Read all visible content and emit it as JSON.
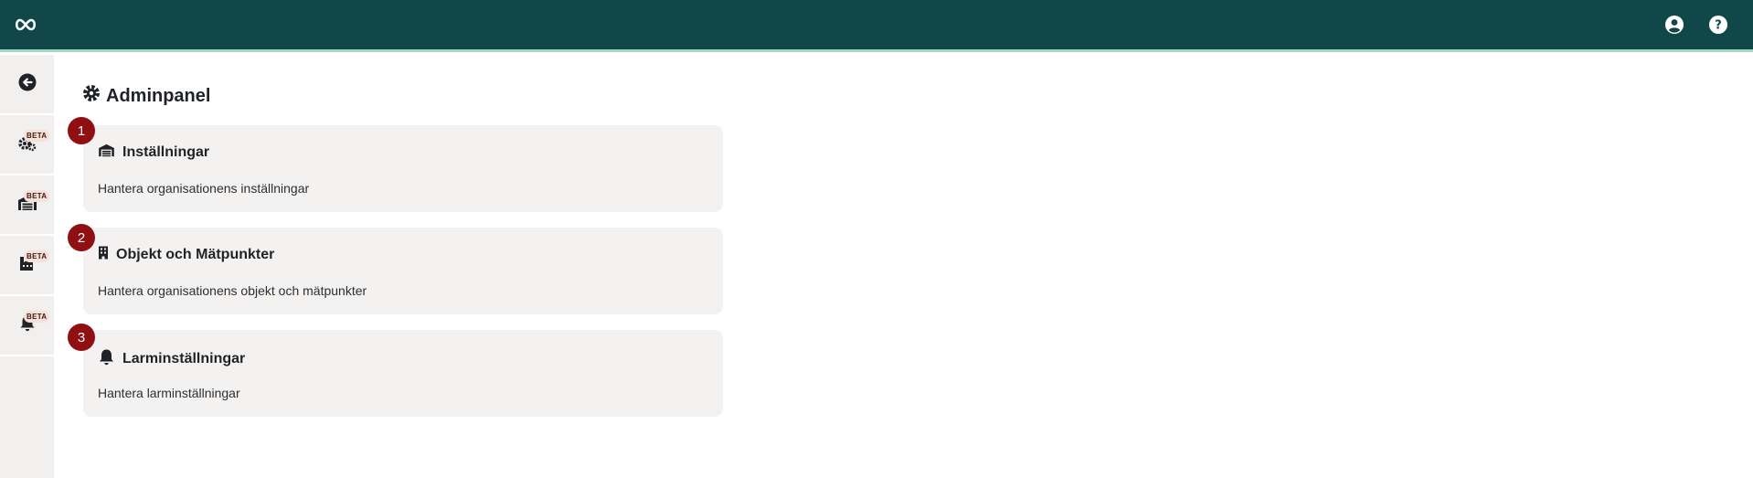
{
  "header": {
    "logo_icon": "infinity-logo-icon",
    "account_icon": "account-circle-icon",
    "help_icon": "help-circle-icon",
    "bg_color": "#124749",
    "accent_color": "#9fd7c0"
  },
  "sidebar": {
    "items": [
      {
        "icon": "arrow-left-circle-icon",
        "badge": ""
      },
      {
        "icon": "gears-icon",
        "badge": "BETA"
      },
      {
        "icon": "warehouse-icon",
        "badge": "BETA"
      },
      {
        "icon": "industry-icon",
        "badge": "BETA"
      },
      {
        "icon": "bell-icon",
        "badge": "BETA"
      }
    ]
  },
  "main": {
    "title": "Adminpanel",
    "title_icon": "gear-icon",
    "cards": [
      {
        "number": "1",
        "icon": "warehouse-icon",
        "title": "Inställningar",
        "description": "Hantera organisationens inställningar"
      },
      {
        "number": "2",
        "icon": "building-icon",
        "title": "Objekt och Mätpunkter",
        "description": "Hantera organisationens objekt och mätpunkter"
      },
      {
        "number": "3",
        "icon": "bell-icon",
        "title": "Larminställningar",
        "description": "Hantera larminställningar"
      }
    ]
  },
  "colors": {
    "badge": "#8f0f12",
    "card_bg": "#f3f2f0",
    "sidebar_bg": "#f1f0ee",
    "beta_bg": "#f6e0d8"
  }
}
